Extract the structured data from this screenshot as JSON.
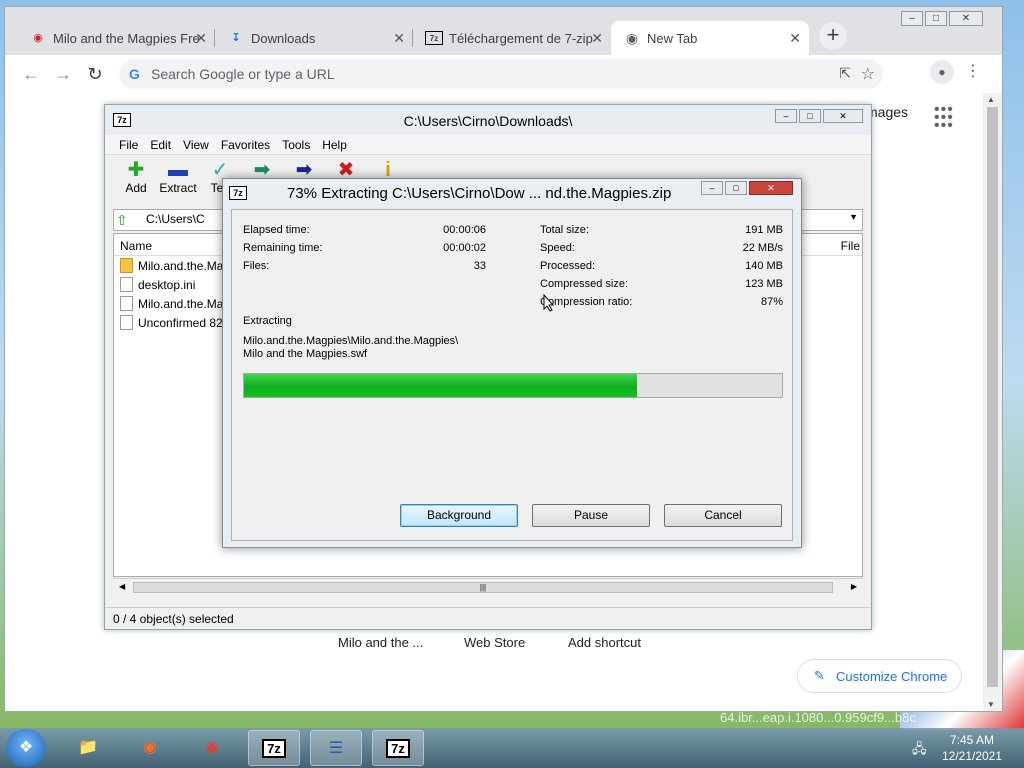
{
  "desktop": {
    "bg_text": "64.ibr...eap.i.1080...0.959cf9...b8c"
  },
  "chrome": {
    "tabs": [
      {
        "label": "Milo and the Magpies Fre",
        "icon": "lock-icon"
      },
      {
        "label": "Downloads",
        "icon": "download-icon"
      },
      {
        "label": "Téléchargement de 7-zip",
        "icon": "7zip-icon"
      },
      {
        "label": "New Tab",
        "icon": "chrome-icon"
      }
    ],
    "omnibox_placeholder": "Search Google or type a URL",
    "images_link": "mages",
    "shortcuts": [
      "Milo and the ...",
      "Web Store",
      "Add shortcut"
    ],
    "customize": "Customize Chrome"
  },
  "filemanager": {
    "title": "C:\\Users\\Cirno\\Downloads\\",
    "menu": [
      "File",
      "Edit",
      "View",
      "Favorites",
      "Tools",
      "Help"
    ],
    "tools": [
      {
        "label": "Add",
        "icon": "add-icon",
        "color": "#22a822"
      },
      {
        "label": "Extract",
        "icon": "extract-icon",
        "color": "#1f3fb0"
      },
      {
        "label": "Tes",
        "icon": "test-icon",
        "color": "#1fb2b2"
      },
      {
        "label": "",
        "icon": "copy-icon",
        "color": "#1e8a6a"
      },
      {
        "label": "",
        "icon": "move-icon",
        "color": "#1a2a8a"
      },
      {
        "label": "",
        "icon": "delete-icon",
        "color": "#d21b1b"
      },
      {
        "label": "",
        "icon": "info-icon",
        "color": "#d4a900"
      }
    ],
    "address": "C:\\Users\\C",
    "columns": {
      "name": "Name",
      "file": "File"
    },
    "files": [
      {
        "name": "Milo.and.the.Ma",
        "type": "folder"
      },
      {
        "name": "desktop.ini",
        "type": "ini"
      },
      {
        "name": "Milo.and.the.Ma",
        "type": "file"
      },
      {
        "name": "Unconfirmed 82",
        "type": "file"
      }
    ],
    "status": "0 / 4 object(s) selected"
  },
  "dialog": {
    "title": "73% Extracting C:\\Users\\Cirno\\Dow ... nd.the.Magpies.zip",
    "left_stats": [
      {
        "label": "Elapsed time:",
        "value": "00:00:06"
      },
      {
        "label": "Remaining time:",
        "value": "00:00:02"
      },
      {
        "label": "Files:",
        "value": "33"
      }
    ],
    "right_stats": [
      {
        "label": "Total size:",
        "value": "191 MB"
      },
      {
        "label": "Speed:",
        "value": "22 MB/s"
      },
      {
        "label": "Processed:",
        "value": "140 MB"
      },
      {
        "label": "Compressed size:",
        "value": "123 MB"
      },
      {
        "label": "Compression ratio:",
        "value": "87%"
      }
    ],
    "operation": "Extracting",
    "current_path": "Milo.and.the.Magpies\\Milo.and.the.Magpies\\",
    "current_file": "Milo and the Magpies.swf",
    "progress_percent": 73,
    "progress_color": "#13b922",
    "buttons": {
      "background": "Background",
      "pause": "Pause",
      "cancel": "Cancel"
    }
  },
  "taskbar": {
    "items": [
      "explorer-icon",
      "firefox-icon",
      "chrome-icon",
      "7zip-icon",
      "notepad-icon",
      "7zip-icon"
    ],
    "item_labels": {
      "sevenzip": "7z"
    },
    "time": "7:45 AM",
    "date": "12/21/2021"
  }
}
